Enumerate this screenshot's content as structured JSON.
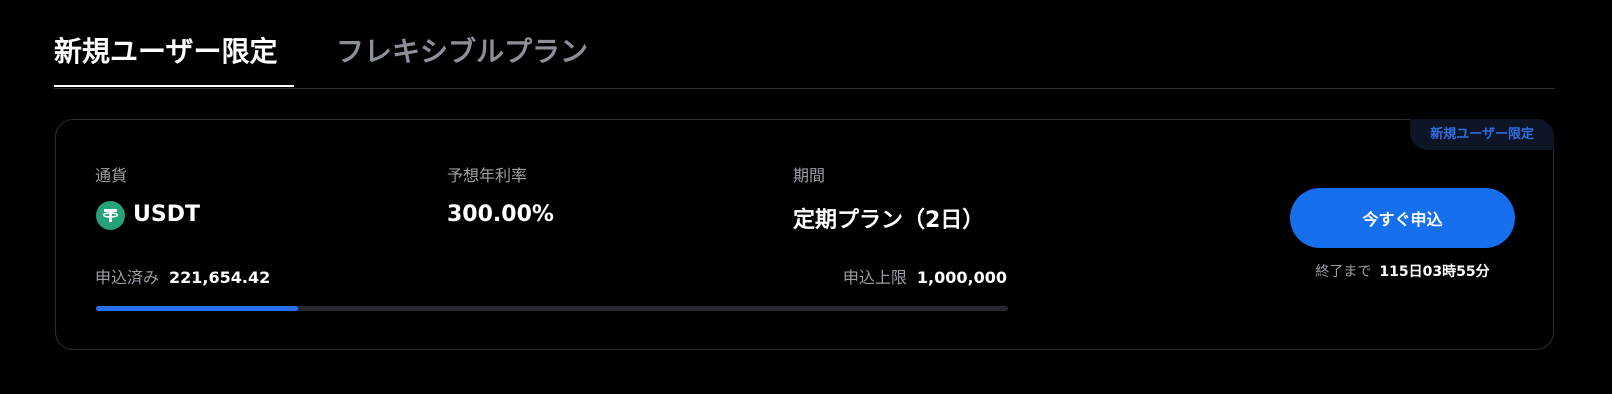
{
  "tabs": [
    {
      "label": "新規ユーザー限定",
      "active": true
    },
    {
      "label": "フレキシブルプラン",
      "active": false
    }
  ],
  "card": {
    "badge": "新規ユーザー限定",
    "currency": {
      "label": "通貨",
      "value": "USDT",
      "icon": "tether-icon"
    },
    "apy": {
      "label": "予想年利率",
      "value": "300.00%"
    },
    "period": {
      "label": "期間",
      "value": "定期プラン（2日）"
    },
    "subscribed": {
      "label": "申込済み",
      "value": "221,654.42"
    },
    "limit": {
      "label": "申込上限",
      "value": "1,000,000"
    },
    "progress_fraction": 0.221654,
    "apply_label": "今すぐ申込",
    "countdown": {
      "label": "終了まで",
      "value": "115日03時55分"
    }
  },
  "colors": {
    "accent": "#1670ee",
    "progress": "#2a6ff0",
    "tether": "#26a17b",
    "badge_text": "#2f6de1"
  }
}
